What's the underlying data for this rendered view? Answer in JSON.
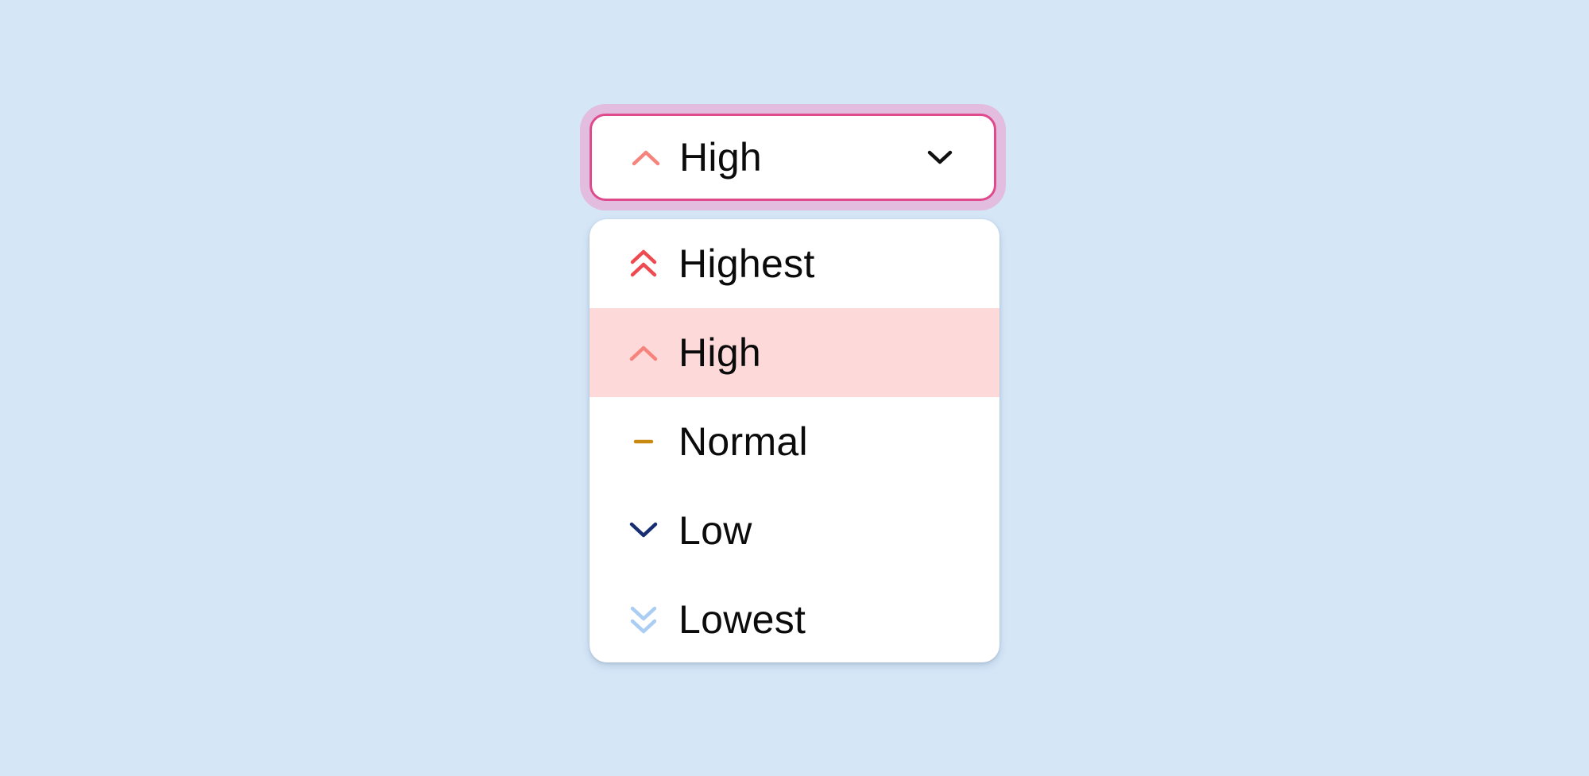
{
  "select": {
    "selected_label": "High",
    "selected_icon": "chevron-up-icon",
    "expand_icon": "chevron-down-icon"
  },
  "options": [
    {
      "label": "Highest",
      "icon": "double-chevron-up-icon",
      "color": "#ef4a4f",
      "selected": false
    },
    {
      "label": "High",
      "icon": "chevron-up-icon",
      "color": "#f6837c",
      "selected": true
    },
    {
      "label": "Normal",
      "icon": "dash-icon",
      "color": "#c98a12",
      "selected": false
    },
    {
      "label": "Low",
      "icon": "chevron-down-icon",
      "color": "#172e72",
      "selected": false
    },
    {
      "label": "Lowest",
      "icon": "double-chevron-down-icon",
      "color": "#a9cdf3",
      "selected": false
    }
  ],
  "colors": {
    "background": "#d5e6f7",
    "focus_border": "#df4a8c",
    "focus_ring": "#e2bde0",
    "selected_row": "#fdd9da"
  }
}
